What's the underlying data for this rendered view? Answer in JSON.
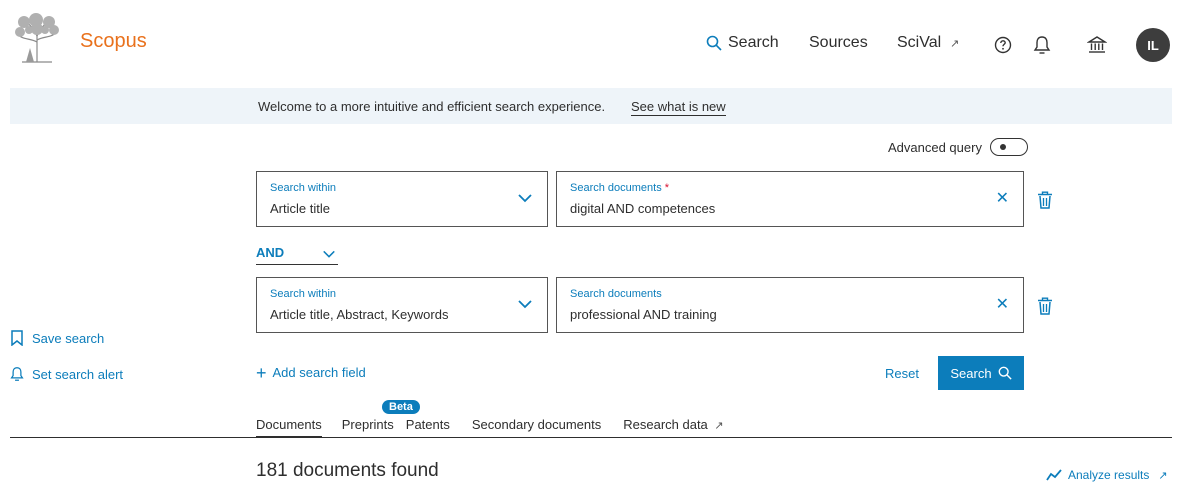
{
  "header": {
    "brand": "Scopus",
    "nav": {
      "search": "Search",
      "sources": "Sources",
      "scival": "SciVal"
    },
    "avatar_initials": "IL"
  },
  "banner": {
    "text": "Welcome to a more intuitive and efficient search experience.",
    "link": "See what is new"
  },
  "advanced_query": {
    "label": "Advanced query",
    "enabled": false
  },
  "search_rows": [
    {
      "within_label": "Search within",
      "within_value": "Article title",
      "docs_label": "Search documents",
      "required_mark": "*",
      "docs_value": "digital AND competences"
    },
    {
      "within_label": "Search within",
      "within_value": "Article title, Abstract, Keywords",
      "docs_label": "Search documents",
      "docs_value": "professional AND training"
    }
  ],
  "boolean_operator": "AND",
  "sidebar": {
    "save_search": "Save search",
    "set_alert": "Set search alert"
  },
  "actions": {
    "add_field": "Add search field",
    "reset": "Reset",
    "search": "Search"
  },
  "tabs": {
    "documents": "Documents",
    "preprints": "Preprints",
    "beta": "Beta",
    "patents": "Patents",
    "secondary": "Secondary documents",
    "research_data": "Research data"
  },
  "results": {
    "found": "181 documents found",
    "analyze": "Analyze results"
  },
  "colors": {
    "brand": "#e9711c",
    "accent": "#0c7dbb",
    "banner_bg": "#eef4f9",
    "required": "#d8102f"
  }
}
